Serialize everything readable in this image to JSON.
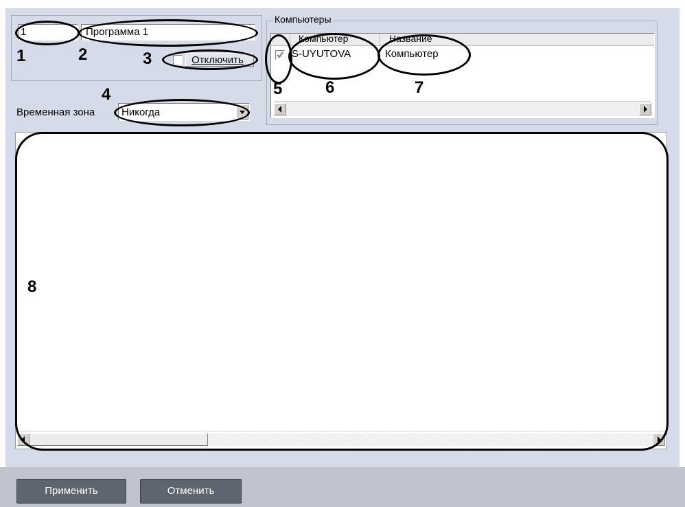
{
  "program": {
    "number_value": "1",
    "name_value": "Программа 1",
    "disable_label": "Отключить",
    "time_zone_label": "Временная зона",
    "time_zone_value": "Никогда"
  },
  "computers": {
    "group_title": "Компьютеры",
    "columns": [
      "Компьютер",
      "Название"
    ],
    "rows": [
      {
        "checked": true,
        "computer": "S-UYUTOVA",
        "name": "Компьютер"
      }
    ]
  },
  "callouts": [
    "1",
    "2",
    "3",
    "4",
    "5",
    "6",
    "7",
    "8"
  ],
  "buttons": {
    "apply_label": "Применить",
    "cancel_label": "Отменить"
  },
  "icons": {
    "scroll_left": "triangle-left-icon",
    "scroll_right": "triangle-right-icon",
    "dropdown": "triangle-down-icon",
    "checkbox": "checkmark-icon"
  }
}
